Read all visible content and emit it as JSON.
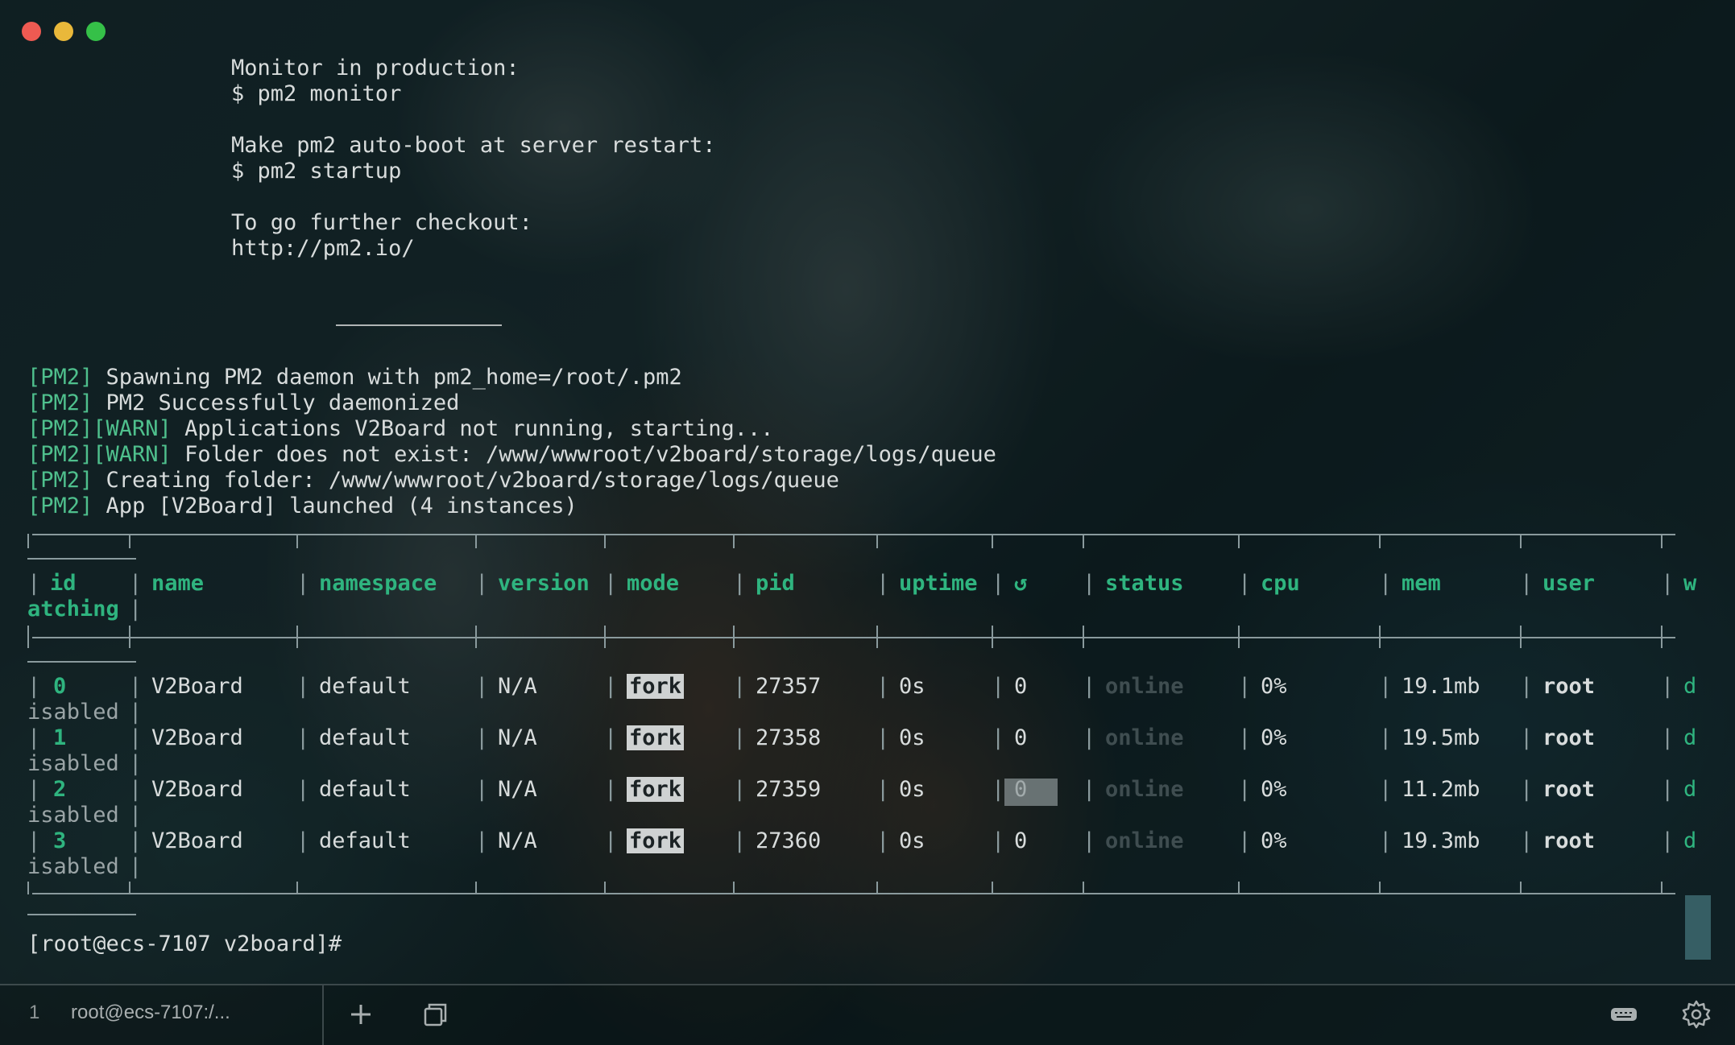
{
  "window": {
    "colors": {
      "close": "#ee5a52",
      "minimize": "#e9b83a",
      "maximize": "#35c048"
    }
  },
  "output": {
    "monitor_heading": "Monitor in production:",
    "monitor_cmd": "$ pm2 monitor",
    "startup_heading": "Make pm2 auto-boot at server restart:",
    "startup_cmd": "$ pm2 startup",
    "further_heading": "To go further checkout:",
    "further_url": "http://pm2.io/",
    "log": [
      {
        "tags": "[PM2]",
        "text": " Spawning PM2 daemon with pm2_home=/root/.pm2"
      },
      {
        "tags": "[PM2]",
        "text": " PM2 Successfully daemonized"
      },
      {
        "tags": "[PM2][WARN]",
        "text": " Applications V2Board not running, starting..."
      },
      {
        "tags": "[PM2][WARN]",
        "text": " Folder does not exist: /www/wwwroot/v2board/storage/logs/queue"
      },
      {
        "tags": "[PM2]",
        "text": " Creating folder: /www/wwwroot/v2board/storage/logs/queue"
      },
      {
        "tags": "[PM2]",
        "text": " App [V2Board] launched (4 instances)"
      }
    ]
  },
  "table": {
    "headers": [
      "id",
      "name",
      "namespace",
      "version",
      "mode",
      "pid",
      "uptime",
      "↺",
      "status",
      "cpu",
      "mem",
      "user",
      "w"
    ],
    "header_wrap": "atching",
    "rows": [
      {
        "id": "0",
        "name": "V2Board",
        "namespace": "default",
        "version": "N/A",
        "mode": "fork",
        "pid": "27357",
        "uptime": "0s",
        "restarts": "0",
        "status": "online",
        "cpu": "0%",
        "mem": "19.1mb",
        "user": "root",
        "watching": "d",
        "wrap": "isabled"
      },
      {
        "id": "1",
        "name": "V2Board",
        "namespace": "default",
        "version": "N/A",
        "mode": "fork",
        "pid": "27358",
        "uptime": "0s",
        "restarts": "0",
        "status": "online",
        "cpu": "0%",
        "mem": "19.5mb",
        "user": "root",
        "watching": "d",
        "wrap": "isabled"
      },
      {
        "id": "2",
        "name": "V2Board",
        "namespace": "default",
        "version": "N/A",
        "mode": "fork",
        "pid": "27359",
        "uptime": "0s",
        "restarts": "0",
        "status": "online",
        "cpu": "0%",
        "mem": "11.2mb",
        "user": "root",
        "watching": "d",
        "wrap": "isabled"
      },
      {
        "id": "3",
        "name": "V2Board",
        "namespace": "default",
        "version": "N/A",
        "mode": "fork",
        "pid": "27360",
        "uptime": "0s",
        "restarts": "0",
        "status": "online",
        "cpu": "0%",
        "mem": "19.3mb",
        "user": "root",
        "watching": "d",
        "wrap": "isabled"
      }
    ]
  },
  "prompt": "[root@ecs-7107 v2board]#",
  "tabbar": {
    "tab_number": "1",
    "tab_title": "root@ecs-7107:/...",
    "icons": [
      "plus-icon",
      "duplicate-icon",
      "keyboard-icon",
      "gear-icon"
    ]
  }
}
